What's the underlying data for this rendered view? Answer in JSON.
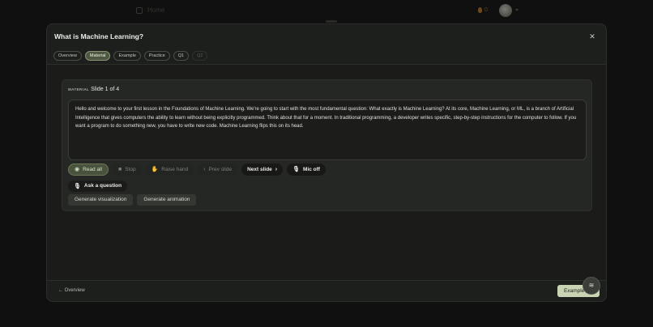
{
  "background": {
    "home_label": "Home",
    "streak_count": "0"
  },
  "modal": {
    "title": "What is Machine Learning?",
    "close_icon": "close-icon",
    "tabs": [
      {
        "label": "Overview",
        "state": "normal"
      },
      {
        "label": "Material",
        "state": "active"
      },
      {
        "label": "Example",
        "state": "normal"
      },
      {
        "label": "Practice",
        "state": "normal"
      },
      {
        "label": "Q1",
        "state": "normal"
      },
      {
        "label": "Q2",
        "state": "disabled"
      }
    ]
  },
  "card": {
    "kicker": "MATERIAL",
    "slide_count": "Slide 1 of 4",
    "body_text": "Hello and welcome to your first lesson in the Foundations of Machine Learning. We're going to start with the most fundamental question: What exactly is Machine Learning? At its core, Machine Learning, or ML, is a branch of Artificial Intelligence that gives computers the ability to learn without being explicitly programmed. Think about that for a moment. In traditional programming, a developer writes specific, step-by-step instructions for the computer to follow. If you want a program to do something new, you have to write new code. Machine Learning flips this on its head.",
    "controls": {
      "read_all": "Read all",
      "stop": "Stop",
      "raise_hand": "Raise hand",
      "prev_slide": "Prev slide",
      "next_slide": "Next slide",
      "mic_off": "Mic off"
    },
    "ask_question": "Ask a question",
    "generate_visualization": "Generate visualization",
    "generate_animation": "Generate animation"
  },
  "footer": {
    "back_label": "← Overview",
    "next_label": "Example"
  },
  "colors": {
    "accent": "#c9d4b4",
    "active_tab": "#4d5640",
    "modal_bg": "#1d1f1c"
  }
}
